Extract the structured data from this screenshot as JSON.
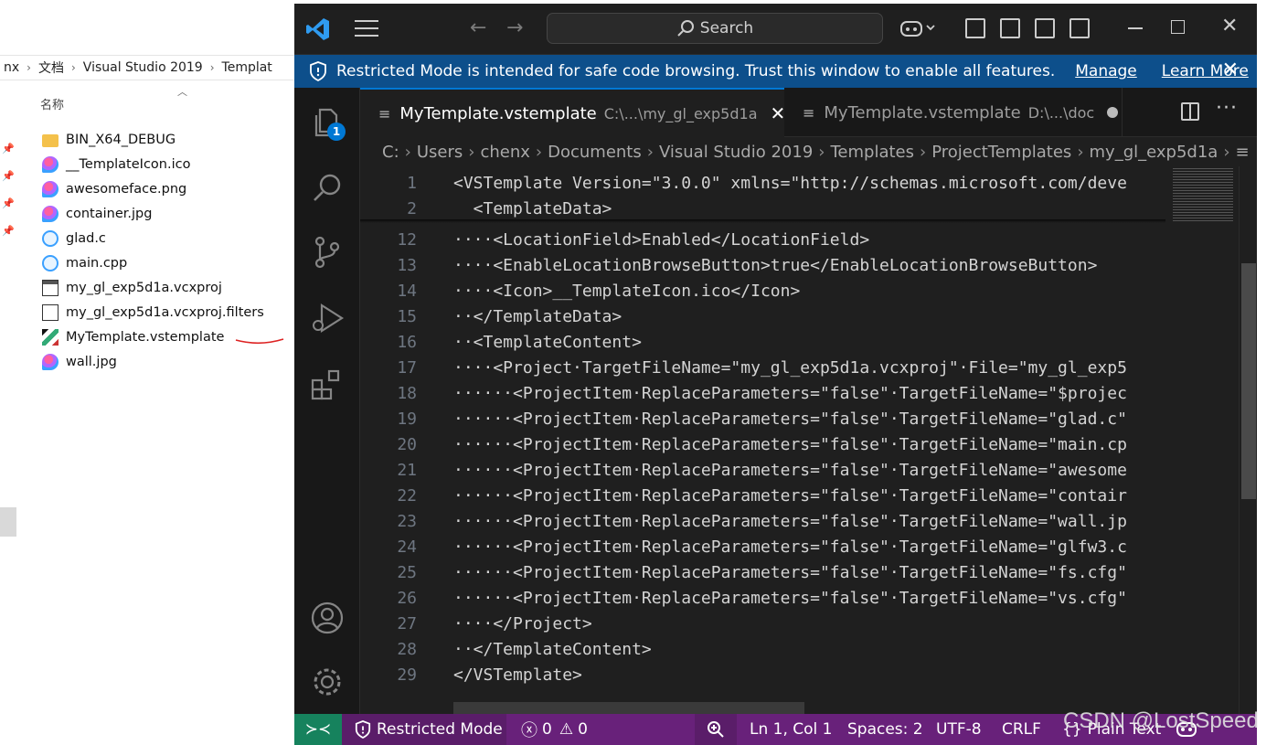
{
  "explorer": {
    "breadcrumb": [
      "nx",
      "文档",
      "Visual Studio 2019",
      "Templat"
    ],
    "column_header": "名称",
    "files": [
      {
        "name": "BIN_X64_DEBUG",
        "icon": "folder-icon"
      },
      {
        "name": "__TemplateIcon.ico",
        "icon": "image-icon"
      },
      {
        "name": "awesomeface.png",
        "icon": "image-icon"
      },
      {
        "name": "container.jpg",
        "icon": "image-icon"
      },
      {
        "name": "glad.c",
        "icon": "c-file-icon"
      },
      {
        "name": "main.cpp",
        "icon": "c-file-icon"
      },
      {
        "name": "my_gl_exp5d1a.vcxproj",
        "icon": "project-file-icon"
      },
      {
        "name": "my_gl_exp5d1a.vcxproj.filters",
        "icon": "filters-file-icon"
      },
      {
        "name": "MyTemplate.vstemplate",
        "icon": "template-file-icon"
      },
      {
        "name": "wall.jpg",
        "icon": "image-icon"
      }
    ]
  },
  "vscode": {
    "search_label": "Search",
    "banner": {
      "text": "Restricted Mode is intended for safe code browsing. Trust this window to enable all features.",
      "manage": "Manage",
      "learn_more": "Learn More",
      "color": "#0d4f8b"
    },
    "badge_count": "1",
    "tabs": [
      {
        "title": "MyTemplate.vstemplate",
        "path": "C:\\...\\my_gl_exp5d1a"
      },
      {
        "title": "MyTemplate.vstemplate",
        "path": "D:\\...\\doc"
      }
    ],
    "breadcrumbs": [
      "C:",
      "Users",
      "chenx",
      "Documents",
      "Visual Studio 2019",
      "Templates",
      "ProjectTemplates",
      "my_gl_exp5d1a"
    ],
    "lines": [
      {
        "n": "1",
        "text": "<VSTemplate Version=\"3.0.0\" xmlns=\"http://schemas.microsoft.com/deve"
      },
      {
        "n": "2",
        "text": "  <TemplateData>"
      },
      {
        "n": "12",
        "text": "····<LocationField>Enabled</LocationField>"
      },
      {
        "n": "13",
        "text": "····<EnableLocationBrowseButton>true</EnableLocationBrowseButton>"
      },
      {
        "n": "14",
        "text": "····<Icon>__TemplateIcon.ico</Icon>"
      },
      {
        "n": "15",
        "text": "··</TemplateData>"
      },
      {
        "n": "16",
        "text": "··<TemplateContent>"
      },
      {
        "n": "17",
        "text": "····<Project·TargetFileName=\"my_gl_exp5d1a.vcxproj\"·File=\"my_gl_exp5"
      },
      {
        "n": "18",
        "text": "······<ProjectItem·ReplaceParameters=\"false\"·TargetFileName=\"$projec"
      },
      {
        "n": "19",
        "text": "······<ProjectItem·ReplaceParameters=\"false\"·TargetFileName=\"glad.c\""
      },
      {
        "n": "20",
        "text": "······<ProjectItem·ReplaceParameters=\"false\"·TargetFileName=\"main.cp"
      },
      {
        "n": "21",
        "text": "······<ProjectItem·ReplaceParameters=\"false\"·TargetFileName=\"awesome"
      },
      {
        "n": "22",
        "text": "······<ProjectItem·ReplaceParameters=\"false\"·TargetFileName=\"contair"
      },
      {
        "n": "23",
        "text": "······<ProjectItem·ReplaceParameters=\"false\"·TargetFileName=\"wall.jp"
      },
      {
        "n": "24",
        "text": "······<ProjectItem·ReplaceParameters=\"false\"·TargetFileName=\"glfw3.c"
      },
      {
        "n": "25",
        "text": "······<ProjectItem·ReplaceParameters=\"false\"·TargetFileName=\"fs.cfg\""
      },
      {
        "n": "26",
        "text": "······<ProjectItem·ReplaceParameters=\"false\"·TargetFileName=\"vs.cfg\""
      },
      {
        "n": "27",
        "text": "····</Project>"
      },
      {
        "n": "28",
        "text": "··</TemplateContent>"
      },
      {
        "n": "29",
        "text": "</VSTemplate>"
      }
    ],
    "status": {
      "restricted": "Restricted Mode",
      "errors": "0",
      "warnings": "0",
      "position": "Ln 1, Col 1",
      "spaces": "Spaces: 2",
      "encoding": "UTF-8",
      "eol": "CRLF",
      "language": "Plain Text",
      "color": "#68217a"
    }
  },
  "watermark": "CSDN @LostSpeed"
}
